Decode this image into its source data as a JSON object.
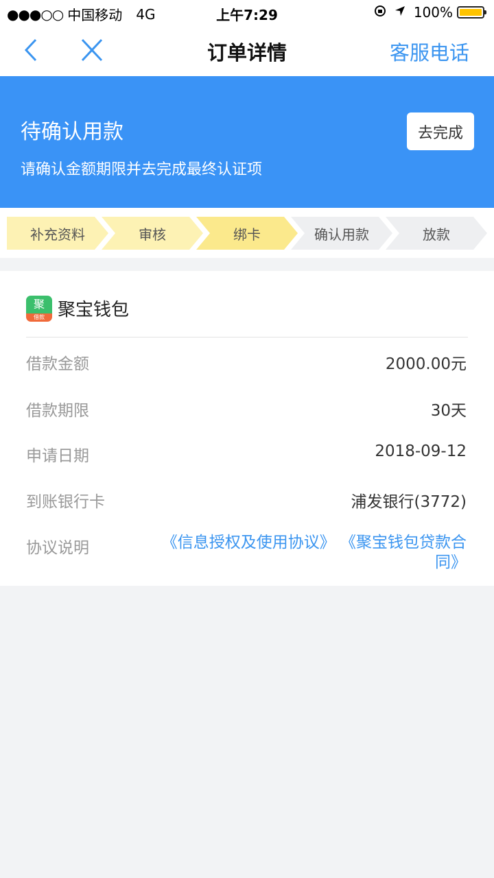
{
  "status_bar": {
    "signal": "●●●○○",
    "carrier": "中国移动",
    "network": "4G",
    "time": "上午7:29",
    "battery": "100%"
  },
  "nav": {
    "title": "订单详情",
    "service": "客服电话"
  },
  "banner": {
    "title": "待确认用款",
    "subtitle": "请确认金额期限并去完成最终认证项",
    "button": "去完成"
  },
  "steps": [
    {
      "label": "补充资料",
      "state": "done"
    },
    {
      "label": "审核",
      "state": "done"
    },
    {
      "label": "绑卡",
      "state": "current"
    },
    {
      "label": "确认用款",
      "state": "pending"
    },
    {
      "label": "放款",
      "state": "pending"
    }
  ],
  "colors": {
    "accent": "#3b95f0",
    "banner": "#3a93f6",
    "step_done": "#fdf2b4",
    "step_current": "#fbe98c",
    "step_pending": "#eeeff1"
  },
  "order": {
    "brand": "聚宝钱包",
    "logo_top": "聚",
    "logo_bottom": "借款",
    "rows": [
      {
        "label": "借款金额",
        "value": "2000.00元"
      },
      {
        "label": "借款期限",
        "value": "30天"
      },
      {
        "label": "申请日期",
        "value": "2018-09-12"
      },
      {
        "label": "到账银行卡",
        "value": "浦发银行(3772)"
      }
    ],
    "agreement_label": "协议说明",
    "agreements": [
      "《信息授权及使用协议》",
      "《聚宝钱包贷款合同》"
    ]
  }
}
